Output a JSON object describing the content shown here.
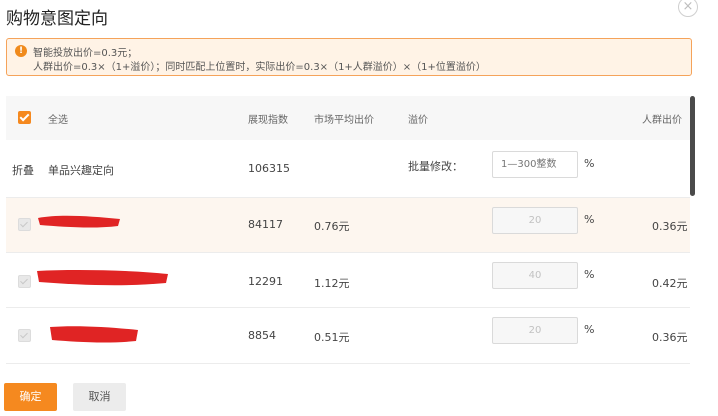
{
  "dialog": {
    "title": "购物意图定向",
    "close_symbol": "×"
  },
  "notice": {
    "icon": "warning-icon",
    "line1": "智能投放出价=0.3元；",
    "line2": "人群出价=0.3×（1+溢价）；同时匹配上位置时，实际出价=0.3×（1+人群溢价）×（1+位置溢价）"
  },
  "table": {
    "header": {
      "select_all": "全选",
      "impression_index": "展现指数",
      "avg_market_bid": "市场平均出价",
      "premium": "溢价",
      "crowd_bid": "人群出价"
    },
    "group_row": {
      "toggle": "折叠",
      "name": "单品兴趣定向",
      "impression_index": "106315",
      "batch_label": "批量修改：",
      "batch_placeholder": "1—300整数",
      "percent": "%"
    },
    "rows": [
      {
        "impression_index": "84117",
        "avg_market_bid": "0.76元",
        "premium": "20",
        "percent": "%",
        "crowd_bid": "0.36元",
        "name_partial": "",
        "checked": true
      },
      {
        "impression_index": "12291",
        "avg_market_bid": "1.12元",
        "premium": "40",
        "percent": "%",
        "crowd_bid": "0.42元",
        "name_partial": "",
        "checked": true
      },
      {
        "impression_index": "8854",
        "avg_market_bid": "0.51元",
        "premium": "20",
        "percent": "%",
        "crowd_bid": "0.36元",
        "name_partial": "",
        "checked": true
      }
    ]
  },
  "footer": {
    "confirm": "确定",
    "cancel": "取消"
  },
  "colors": {
    "accent": "#f5891f",
    "notice_bg": "#fff3e6",
    "highlight_row": "#fdf6ef",
    "redaction": "#e02424"
  }
}
